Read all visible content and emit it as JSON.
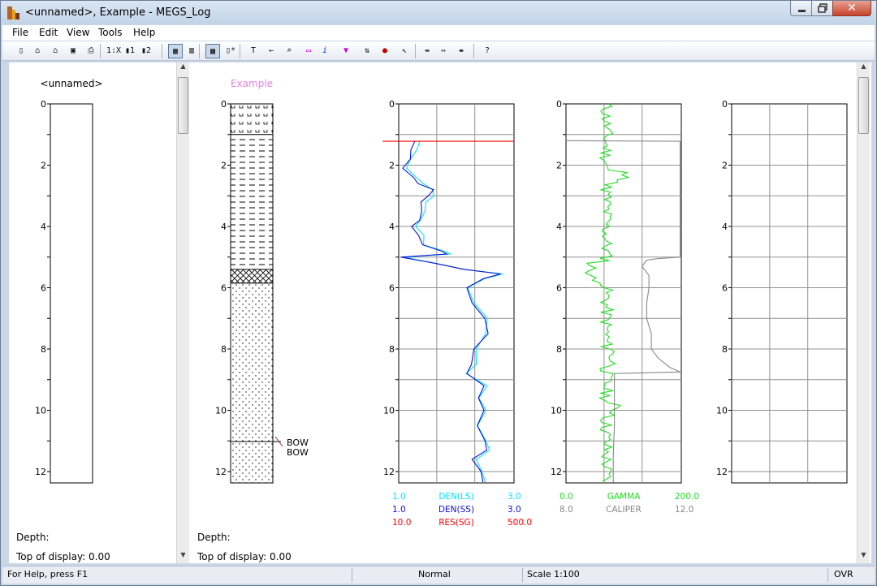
{
  "window": {
    "title": "<unnamed>, Example - MEGS_Log"
  },
  "menu": [
    "File",
    "Edit",
    "View",
    "Tools",
    "Help"
  ],
  "toolbar": {
    "icons": [
      "new-icon",
      "open-icon",
      "open-folder-icon",
      "save-icon",
      "print-icon",
      "scale-1x-icon",
      "track-1-icon",
      "track-2-icon",
      "grid-icon",
      "column-icon",
      "fill-icon",
      "add-track-icon",
      "tops-icon",
      "back-arrow-icon",
      "zoom-icon",
      "add-note-icon",
      "info-icon",
      "fill-down-icon",
      "sort-icon",
      "add-point-icon",
      "pointer-icon",
      "move-icon",
      "spread-icon",
      "collapse-icon",
      "help-pointer-icon"
    ],
    "scale_label": "1:X"
  },
  "pane_left": {
    "well_name": "<unnamed>",
    "depth_label": "Depth:",
    "top_label": "Top of display: 0.00"
  },
  "pane_right": {
    "well_name": "Example",
    "depth_label": "Depth:",
    "top_label": "Top of display: 0.00"
  },
  "depth_ticks": [
    "0",
    "2",
    "4",
    "6",
    "8",
    "10",
    "12"
  ],
  "lithology": {
    "tops": [
      "BOW",
      "BOW"
    ]
  },
  "track_den_res": {
    "legends": [
      {
        "min": "1.0",
        "name": "DEN(LS)",
        "max": "3.0",
        "color": "#00e5ff"
      },
      {
        "min": "1.0",
        "name": "DEN(SS)",
        "max": "3.0",
        "color": "#1010d0"
      },
      {
        "min": "10.0",
        "name": "RES(SG)",
        "max": "500.0",
        "color": "#ff0000"
      }
    ]
  },
  "track_gamma": {
    "legends": [
      {
        "min": "0.0",
        "name": "GAMMA",
        "max": "200.0",
        "color": "#22dd22"
      },
      {
        "min": "8.0",
        "name": "CALIPER",
        "max": "12.0",
        "color": "#888888"
      }
    ]
  },
  "status": {
    "help": "For Help, press F1",
    "mode": "Normal",
    "scale": "Scale 1:100",
    "ovr": "OVR"
  }
}
